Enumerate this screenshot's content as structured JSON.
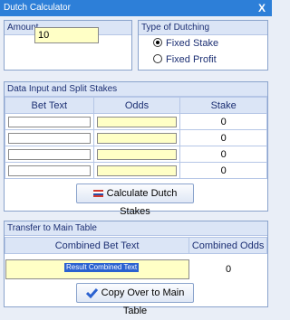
{
  "window": {
    "title": "Dutch Calculator",
    "close_glyph": "X"
  },
  "amount": {
    "header": "Amount",
    "value": "10"
  },
  "type_of_dutching": {
    "header": "Type of Dutching",
    "options": [
      {
        "label": "Fixed Stake",
        "selected": true
      },
      {
        "label": "Fixed Profit",
        "selected": false
      }
    ]
  },
  "data_input": {
    "header": "Data Input and Split Stakes",
    "columns": [
      "Bet Text",
      "Odds",
      "Stake"
    ],
    "rows": [
      {
        "bet_text": "",
        "odds": "",
        "stake": "0"
      },
      {
        "bet_text": "",
        "odds": "",
        "stake": "0"
      },
      {
        "bet_text": "",
        "odds": "",
        "stake": "0"
      },
      {
        "bet_text": "",
        "odds": "",
        "stake": "0"
      }
    ],
    "calculate_button": "Calculate Dutch Stakes"
  },
  "transfer": {
    "header": "Transfer to Main Table",
    "columns": [
      "Combined Bet Text",
      "Combined Odds"
    ],
    "combined_bet_text": "Result Combined Text",
    "combined_odds": "0",
    "copy_button": "Copy Over to Main Table"
  },
  "icons": {
    "calculate": "flag-icon",
    "copy": "checkmark-icon"
  },
  "colors": {
    "title_bar": "#2d7fd8",
    "input_yellow": "#ffffc6",
    "group_header": "#dbe5f6",
    "header_text": "#1c2f73"
  }
}
